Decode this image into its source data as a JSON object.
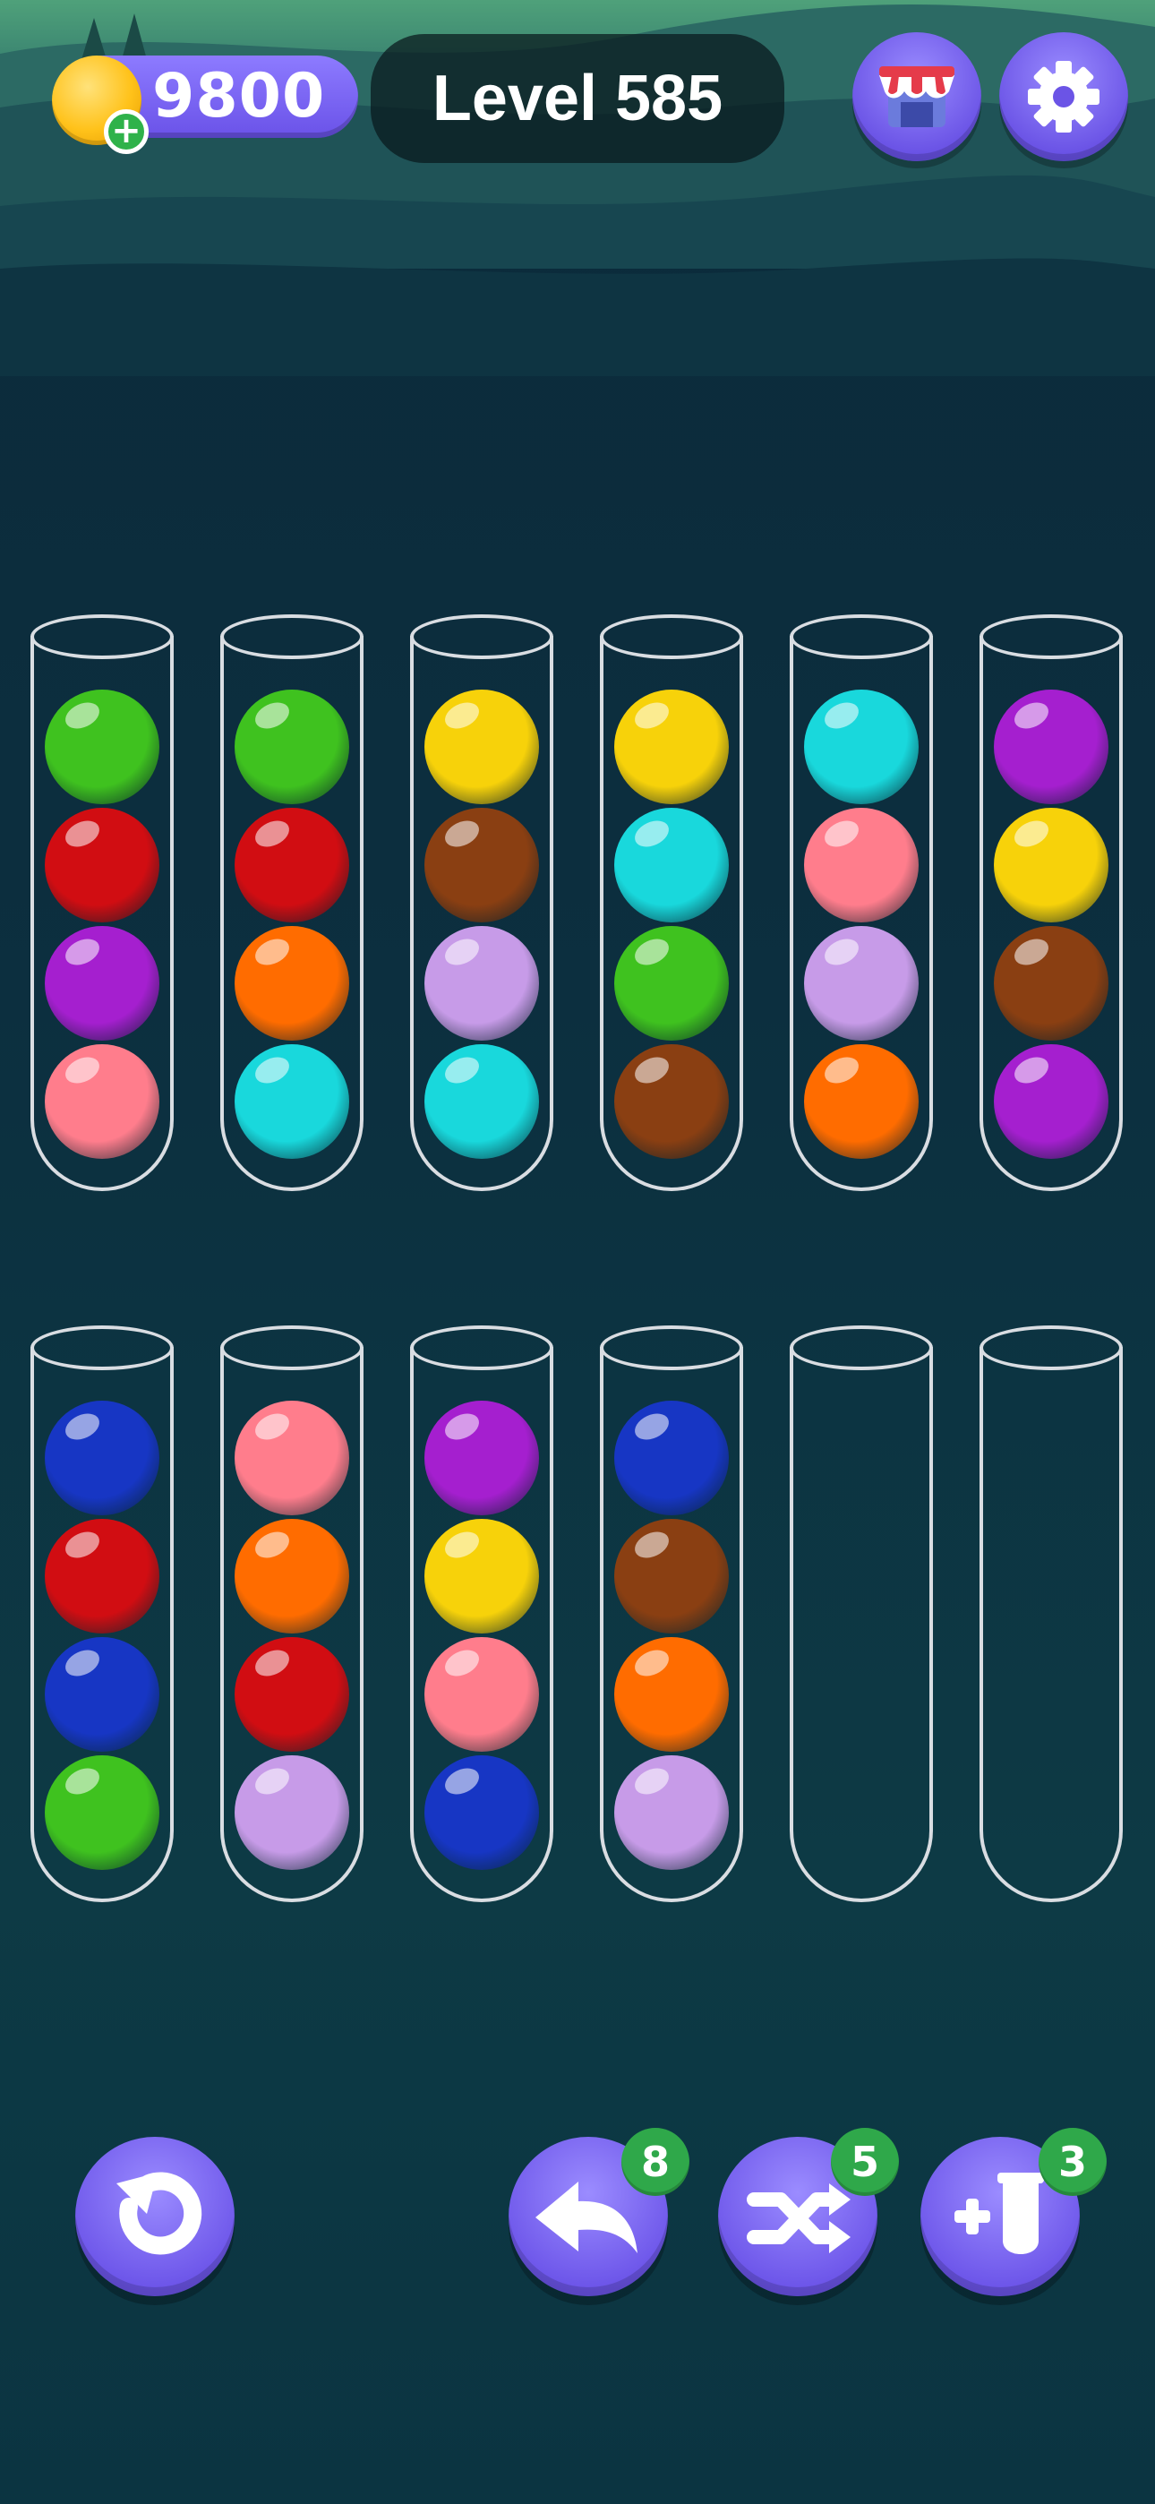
{
  "header": {
    "coins": "9800",
    "level_label": "Level 585"
  },
  "tubes_row1": [
    [
      "green",
      "red",
      "purple",
      "pink"
    ],
    [
      "green",
      "red",
      "orange",
      "cyan"
    ],
    [
      "yellow",
      "brown",
      "lavender",
      "cyan"
    ],
    [
      "yellow",
      "cyan",
      "green",
      "brown"
    ],
    [
      "cyan",
      "pink",
      "lavender",
      "orange"
    ],
    [
      "purple",
      "yellow",
      "brown",
      "purple"
    ]
  ],
  "tubes_row2": [
    [
      "blue",
      "red",
      "blue",
      "green"
    ],
    [
      "pink",
      "orange",
      "red",
      "lavender"
    ],
    [
      "purple",
      "yellow",
      "pink",
      "blue"
    ],
    [
      "blue",
      "brown",
      "orange",
      "lavender"
    ],
    [],
    []
  ],
  "colors": {
    "green": "#3fc21f",
    "red": "#d10d12",
    "purple": "#a51fcf",
    "pink": "#ff7d8c",
    "orange": "#ff6c00",
    "cyan": "#19d8dc",
    "yellow": "#f7d20a",
    "brown": "#8a3f12",
    "lavender": "#c79be8",
    "blue": "#1736c4"
  },
  "boosters": {
    "undo_count": "8",
    "shuffle_count": "5",
    "add_tube_count": "3"
  },
  "icons": {
    "shop": "shop-icon",
    "settings": "gear-icon",
    "restart": "restart-icon",
    "undo": "undo-icon",
    "shuffle": "shuffle-icon",
    "add_tube": "add-tube-icon"
  }
}
